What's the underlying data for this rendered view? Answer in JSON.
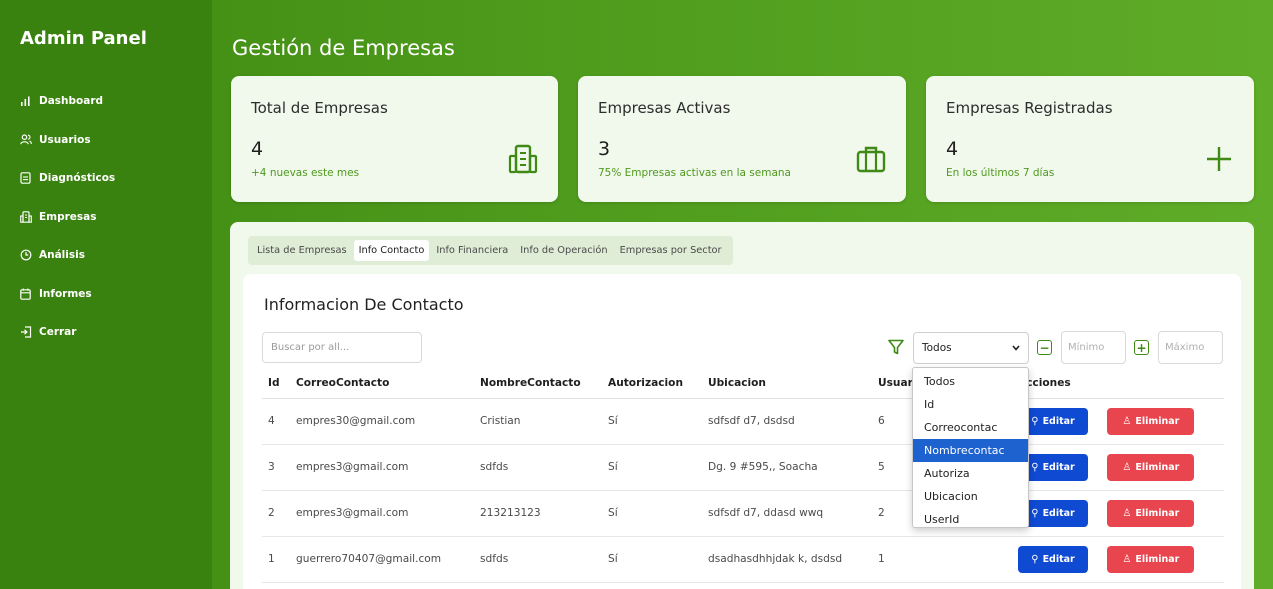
{
  "sidebar": {
    "brand": "Admin Panel",
    "items": [
      {
        "label": "Dashboard",
        "icon": "bar-chart-icon"
      },
      {
        "label": "Usuarios",
        "icon": "users-icon"
      },
      {
        "label": "Diagnósticos",
        "icon": "document-icon"
      },
      {
        "label": "Empresas",
        "icon": "building-icon"
      },
      {
        "label": "Análisis",
        "icon": "clock-icon"
      },
      {
        "label": "Informes",
        "icon": "calendar-icon"
      },
      {
        "label": "Cerrar",
        "icon": "logout-icon"
      }
    ]
  },
  "header": {
    "title": "Gestión de Empresas"
  },
  "stats": [
    {
      "title": "Total de Empresas",
      "value": "4",
      "sub": "+4 nuevas este mes",
      "icon": "building-icon"
    },
    {
      "title": "Empresas Activas",
      "value": "3",
      "sub": "75% Empresas activas en la semana",
      "icon": "briefcase-icon"
    },
    {
      "title": "Empresas Registradas",
      "value": "4",
      "sub": "En los últimos 7 días",
      "icon": "plus-icon"
    }
  ],
  "tabs": [
    "Lista de Empresas",
    "Info Contacto",
    "Info Financiera",
    "Info de Operación",
    "Empresas por Sector"
  ],
  "active_tab": "Info Contacto",
  "card": {
    "title": "Informacion De Contacto",
    "search_placeholder": "Buscar por all...",
    "filter_selected": "Todos",
    "min_placeholder": "Mínimo",
    "max_placeholder": "Máximo"
  },
  "table": {
    "columns": [
      "Id",
      "CorreoContacto",
      "NombreContacto",
      "Autorizacion",
      "Ubicacion",
      "Usuar",
      "Acciones"
    ],
    "rows": [
      [
        "4",
        "empres30@gmail.com",
        "Cristian",
        "Sí",
        "sdfsdf d7, dsdsd",
        "6"
      ],
      [
        "3",
        "empres3@gmail.com",
        "sdfds",
        "Sí",
        "Dg. 9 #595,, Soacha",
        "5"
      ],
      [
        "2",
        "empres3@gmail.com",
        "213213123",
        "Sí",
        "sdfsdf d7, ddasd wwq",
        "2"
      ],
      [
        "1",
        "guerrero70407@gmail.com",
        "sdfds",
        "Sí",
        "dsadhasdhhjdak k, dsdsd",
        "1"
      ]
    ],
    "edit_label": "Editar",
    "delete_label": "Eliminar"
  },
  "dropdown": {
    "options": [
      "Todos",
      "Id",
      "Correocontac",
      "Nombrecontac",
      "Autoriza",
      "Ubicacion",
      "UserId"
    ],
    "highlighted": "Nombrecontac"
  },
  "colors": {
    "brand_green": "#3a820f",
    "edit_blue": "#0f4ad3",
    "delete_red": "#e9454f",
    "highlight_blue": "#1e62cf"
  }
}
